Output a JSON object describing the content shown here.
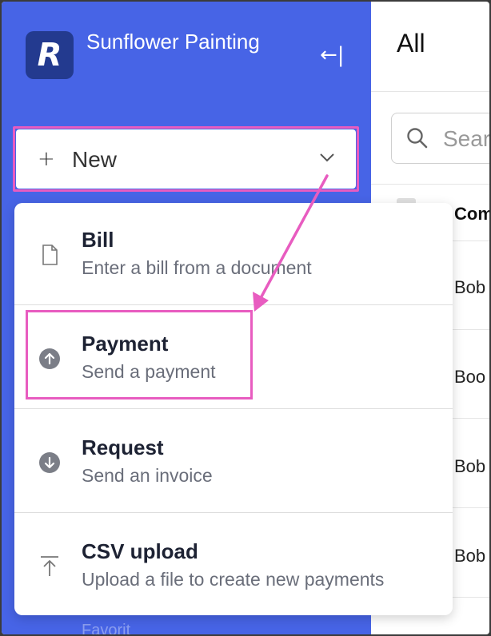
{
  "sidebar": {
    "company_name": "Sunflower Painting",
    "logo_letter": "R",
    "collapse_glyph": "←|",
    "new_button": {
      "plus": "+",
      "label": "New"
    },
    "faded_text": "Favorit"
  },
  "dropdown": {
    "items": [
      {
        "title": "Bill",
        "subtitle": "Enter a bill from a document",
        "icon": "document-icon"
      },
      {
        "title": "Payment",
        "subtitle": "Send a payment",
        "icon": "arrow-up-circle-icon"
      },
      {
        "title": "Request",
        "subtitle": "Send an invoice",
        "icon": "arrow-down-circle-icon"
      },
      {
        "title": "CSV upload",
        "subtitle": "Upload a file to create new payments",
        "icon": "upload-icon"
      }
    ]
  },
  "main": {
    "title": "All",
    "search_placeholder": "Search",
    "column_header": "Company",
    "rows": [
      "Bob",
      "Boo",
      "Bob",
      "Bob"
    ]
  },
  "annotation": {
    "highlight_color": "#e85cc0"
  }
}
